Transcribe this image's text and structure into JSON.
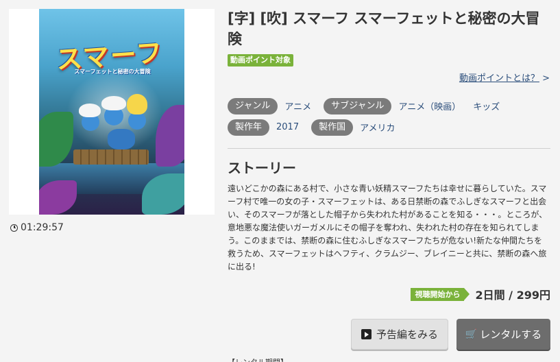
{
  "poster": {
    "logo_text": "スマーフ",
    "logo_subtitle": "スマーフェットと秘密の大冒険"
  },
  "duration": "01:29:57",
  "title": "[字] [吹] スマーフ スマーフェットと秘密の大冒険",
  "point_badge": "動画ポイント対象",
  "point_link": {
    "label": "動画ポイントとは？",
    "arrow": ">"
  },
  "tags": {
    "genre_label": "ジャンル",
    "genre_value": "アニメ",
    "subgenre_label": "サブジャンル",
    "subgenre_values": [
      "アニメ（映画）",
      "キッズ"
    ],
    "year_label": "製作年",
    "year_value": "2017",
    "country_label": "製作国",
    "country_value": "アメリカ"
  },
  "story": {
    "heading": "ストーリー",
    "text": "遠いどこかの森にある村で、小さな青い妖精スマーフたちは幸せに暮らしていた。スマーフ村で唯一の女の子・スマーフェットは、ある日禁断の森でふしぎなスマーフと出会い、そのスマーフが落とした帽子から失われた村があることを知る・・・。ところが、意地悪な魔法使いガーガメルにその帽子を奪われ、失われた村の存在を知られてしまう。このままでは、禁断の森に住むふしぎなスマーフたちが危ない!新たな仲間たちを救うため、スマーフェットはヘフティ、クラムジー、ブレイニーと共に、禁断の森へ旅に出る!"
  },
  "rental": {
    "period_badge": "視聴開始から",
    "price": "2日間 / 299円"
  },
  "buttons": {
    "trailer": "予告編をみる",
    "rent": "レンタルする"
  },
  "rental_note": "【レンタル期間】",
  "colors": {
    "accent_green": "#7ab23a",
    "tag_gray": "#7b7b7b",
    "link_blue": "#2a4d7a",
    "rent_button": "#6d6d6d"
  }
}
